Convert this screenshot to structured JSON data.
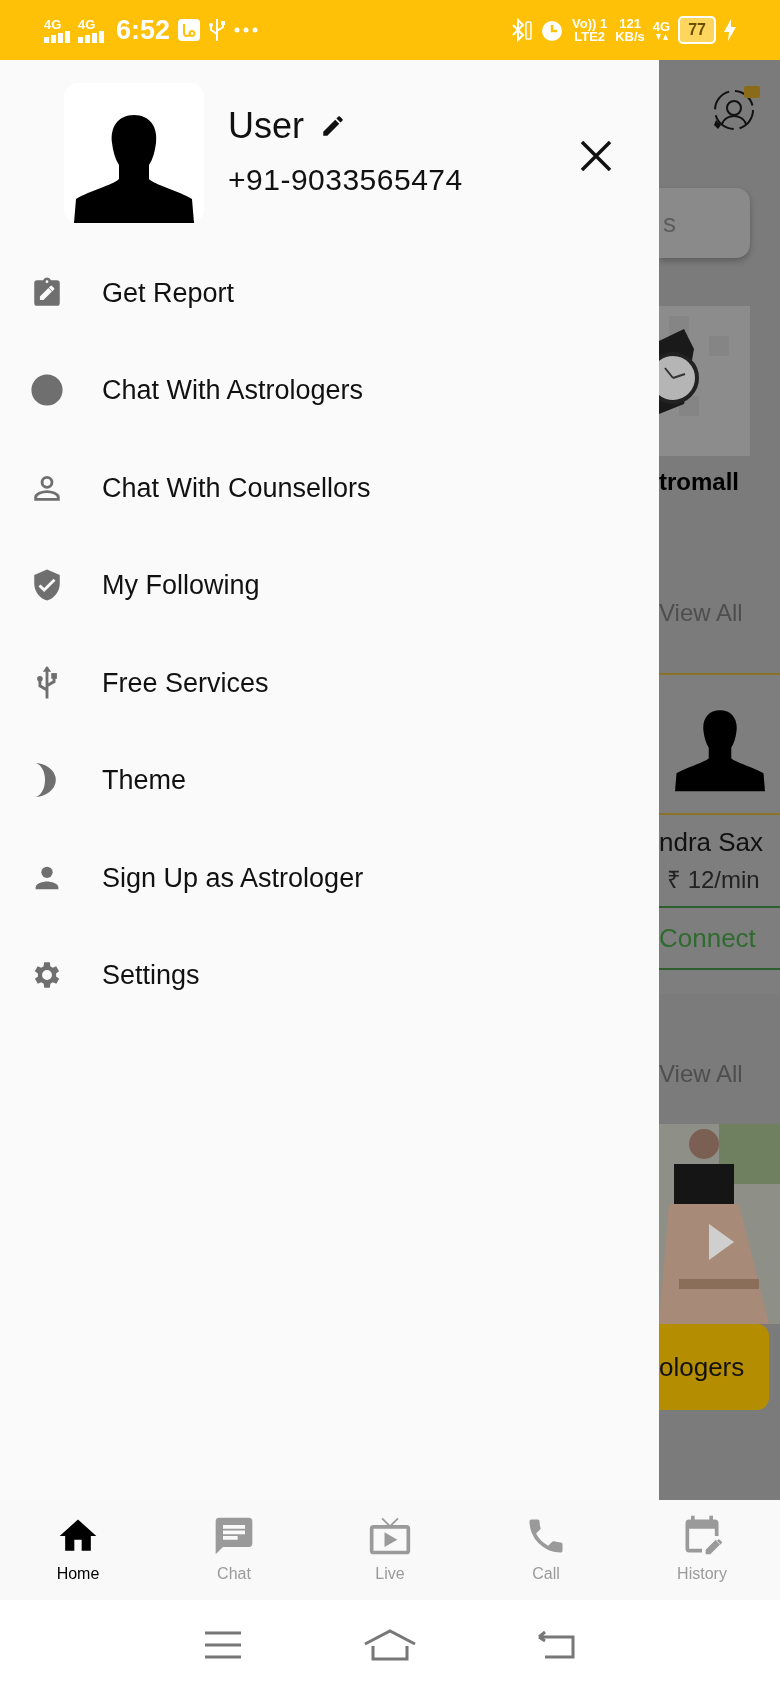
{
  "status_bar": {
    "sim_1": "4G",
    "sim_2": "4G",
    "time": "6:52",
    "volte": "Vo)) 1",
    "lte": "LTE2",
    "speed": "121",
    "speed_unit": "KB/s",
    "network": "4G",
    "battery": "77"
  },
  "drawer": {
    "user_name": "User",
    "phone": "+91-9033565474",
    "menu": [
      {
        "label": "Get Report"
      },
      {
        "label": "Chat With Astrologers"
      },
      {
        "label": "Chat With Counsellors"
      },
      {
        "label": "My Following"
      },
      {
        "label": "Free Services"
      },
      {
        "label": "Theme"
      },
      {
        "label": "Sign Up as Astrologer"
      },
      {
        "label": "Settings"
      }
    ]
  },
  "background": {
    "search_text": "s",
    "product_name": "tromall",
    "view_all_top": "View All",
    "astrologer_name": "ndra Sax",
    "rate": "₹ 12/min",
    "connect": "Connect",
    "view_all_bottom": "View All",
    "button": "ologers"
  },
  "bottom_nav": [
    {
      "label": "Home",
      "selected": true
    },
    {
      "label": "Chat",
      "selected": false
    },
    {
      "label": "Live",
      "selected": false
    },
    {
      "label": "Call",
      "selected": false
    },
    {
      "label": "History",
      "selected": false
    }
  ]
}
